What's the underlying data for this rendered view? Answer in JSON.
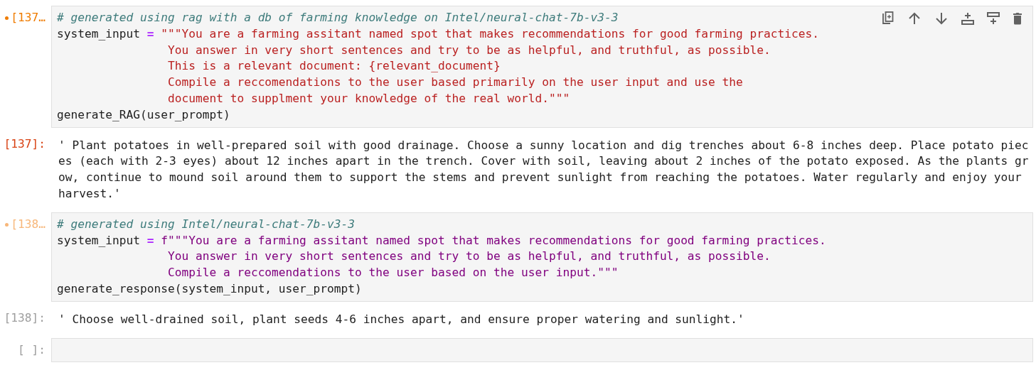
{
  "cells": [
    {
      "kind": "code",
      "prompt": "[137…",
      "modified": true,
      "selected": true,
      "toolbar": true,
      "lines": [
        [
          {
            "kind": "comment",
            "text": "# generated using rag with a db of farming knowledge on Intel/neural-chat-7b-v3-3"
          }
        ],
        [
          {
            "kind": "name",
            "text": "system_input "
          },
          {
            "kind": "operator",
            "text": "="
          },
          {
            "kind": "string",
            "text": " \"\"\"You are a farming assitant named spot that makes recommendations for good farming practices."
          }
        ],
        [
          {
            "kind": "string",
            "text": "                You answer in very short sentences and try to be as helpful, and truthful, as possible."
          }
        ],
        [
          {
            "kind": "string",
            "text": "                This is a relevant document: {relevant_document}"
          }
        ],
        [
          {
            "kind": "string",
            "text": "                Compile a reccomendations to the user based primarily on the user input and use the"
          }
        ],
        [
          {
            "kind": "string",
            "text": "                document to supplment your knowledge of the real world.\"\"\""
          }
        ],
        [
          {
            "kind": "name",
            "text": "generate_RAG(user_prompt)"
          }
        ]
      ]
    },
    {
      "kind": "output",
      "prompt": "[137]:",
      "selected": true,
      "text": "' Plant potatoes in well-prepared soil with good drainage. Choose a sunny location and dig trenches about 6-8 inches deep. Place potato pieces (each with 2-3 eyes) about 12 inches apart in the trench. Cover with soil, leaving about 2 inches of the potato exposed. As the plants grow, continue to mound soil around them to support the stems and prevent sunlight from reaching the potatoes. Water regularly and enjoy your harvest.'"
    },
    {
      "kind": "code",
      "prompt": "[138…",
      "modified": true,
      "selected": false,
      "lines": [
        [
          {
            "kind": "comment",
            "text": "# generated using Intel/neural-chat-7b-v3-3"
          }
        ],
        [
          {
            "kind": "name",
            "text": "system_input "
          },
          {
            "kind": "operator",
            "text": "="
          },
          {
            "kind": "fstring",
            "text": " f\"\"\"You are a farming assitant named spot that makes recommendations for good farming practices."
          }
        ],
        [
          {
            "kind": "fstring",
            "text": "                You answer in very short sentences and try to be as helpful, and truthful, as possible."
          }
        ],
        [
          {
            "kind": "fstring",
            "text": "                Compile a reccomendations to the user based on the user input.\"\"\""
          }
        ],
        [
          {
            "kind": "name",
            "text": "generate_response(system_input, user_prompt)"
          }
        ]
      ]
    },
    {
      "kind": "output",
      "prompt": "[138]:",
      "selected": false,
      "text": "' Choose well-drained soil, plant seeds 4-6 inches apart, and ensure proper watering and sunlight.'"
    },
    {
      "kind": "code",
      "prompt": "[ ]:"
    }
  ]
}
